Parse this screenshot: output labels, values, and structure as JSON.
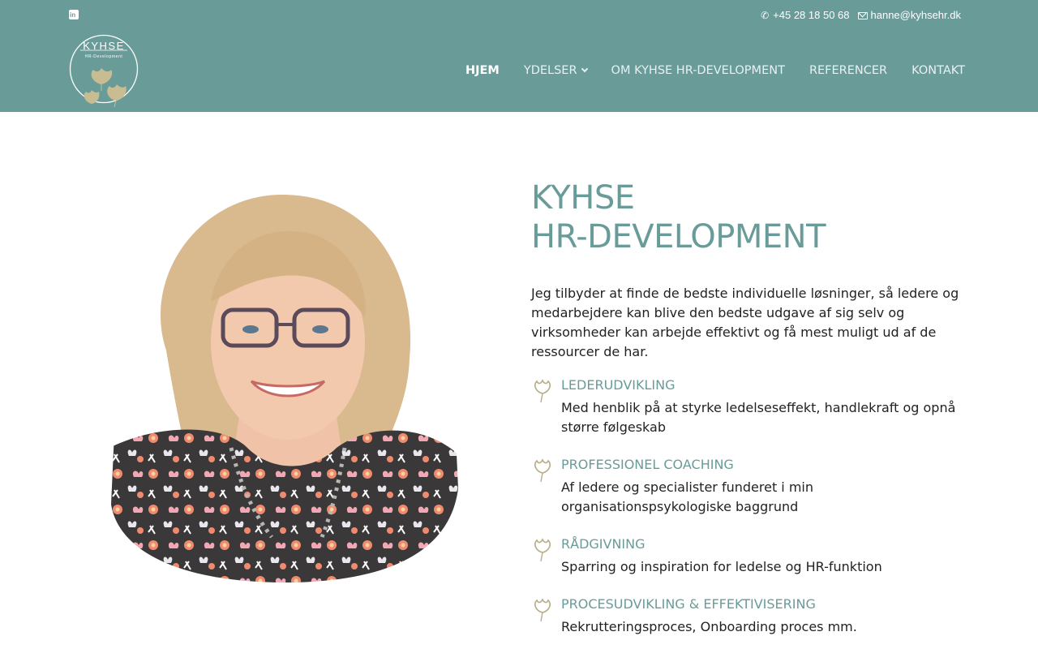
{
  "topbar": {
    "linkedin_icon": "linkedin-icon",
    "phone_icon": "phone-icon",
    "phone": "+45 28 18 50 68",
    "email_icon": "envelope-icon",
    "email": "hanne@kyhsehr.dk"
  },
  "logo": {
    "name": "KYHSE",
    "tagline": "HR-Development"
  },
  "nav": {
    "items": [
      {
        "label": "HJEM",
        "active": true
      },
      {
        "label": "YDELSER",
        "dropdown": true
      },
      {
        "label": "OM KYHSE HR-DEVELOPMENT"
      },
      {
        "label": "REFERENCER"
      },
      {
        "label": "KONTAKT"
      }
    ]
  },
  "hero": {
    "title_line1": "KYHSE",
    "title_line2": "HR-DEVELOPMENT",
    "intro": "Jeg tilbyder at finde de bedste individuelle løsninger, så ledere og medarbejdere kan blive den bedste udgave af sig selv og virksomheder kan arbejde effektivt og få mest muligt ud af de ressourcer de har."
  },
  "services": [
    {
      "title": "LEDERUDVIKLING",
      "desc": "Med henblik på at styrke ledelseseffekt, handlekraft og opnå større følgeskab"
    },
    {
      "title": "PROFESSIONEL COACHING",
      "desc": "Af ledere og specialister funderet i min organisationspsykologiske baggrund"
    },
    {
      "title": "RÅDGIVNING",
      "desc": "Sparring og inspiration for ledelse og HR-funktion"
    },
    {
      "title": "PROCESUDVIKLING & EFFEKTIVISERING",
      "desc": "Rekrutteringsproces, Onboarding proces mm."
    }
  ],
  "colors": {
    "brand": "#699b99",
    "leaf": "#c8bc92",
    "text": "#222222"
  }
}
